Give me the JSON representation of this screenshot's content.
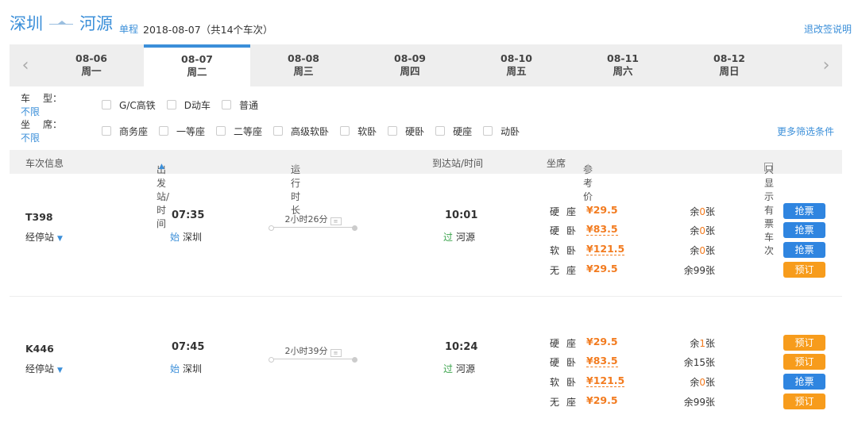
{
  "header": {
    "from": "深圳",
    "to": "河源",
    "trip_type": "单程",
    "date_summary": "2018-08-07（共14个车次）",
    "rules_link": "退改签说明"
  },
  "dates": [
    {
      "date": "08-06",
      "weekday": "周一",
      "active": false
    },
    {
      "date": "08-07",
      "weekday": "周二",
      "active": true
    },
    {
      "date": "08-08",
      "weekday": "周三",
      "active": false
    },
    {
      "date": "08-09",
      "weekday": "周四",
      "active": false
    },
    {
      "date": "08-10",
      "weekday": "周五",
      "active": false
    },
    {
      "date": "08-11",
      "weekday": "周六",
      "active": false
    },
    {
      "date": "08-12",
      "weekday": "周日",
      "active": false
    }
  ],
  "filters": {
    "train_type": {
      "label_a": "车",
      "label_b": "型：",
      "value": "不限",
      "options": [
        "G/C高铁",
        "D动车",
        "普通"
      ]
    },
    "seat_type": {
      "label_a": "坐",
      "label_b": "席：",
      "value": "不限",
      "options": [
        "商务座",
        "一等座",
        "二等座",
        "高级软卧",
        "软卧",
        "硬卧",
        "硬座",
        "动卧"
      ]
    },
    "more": "更多筛选条件"
  },
  "list_header": {
    "train_info": "车次信息",
    "departure": "出发站/时间",
    "duration": "运行时长",
    "arrival": "到达站/时间",
    "seat": "坐席",
    "price": "参考价",
    "only_available": "只显示有票车次"
  },
  "trains": [
    {
      "number": "T398",
      "stops_label": "经停站",
      "dep_time": "07:35",
      "dep_tag": "始",
      "dep_station": "深圳",
      "duration": "2小时26分",
      "arr_time": "10:01",
      "arr_tag": "过",
      "arr_station": "河源",
      "seats": [
        {
          "name": "硬座",
          "price": "¥29.5",
          "remain_pre": "余",
          "remain_n": "0",
          "remain_post": "张",
          "button": "抢票",
          "kind": "blue",
          "dashed": false
        },
        {
          "name": "硬卧",
          "price": "¥83.5",
          "remain_pre": "余",
          "remain_n": "0",
          "remain_post": "张",
          "button": "抢票",
          "kind": "blue",
          "dashed": true
        },
        {
          "name": "软卧",
          "price": "¥121.5",
          "remain_pre": "余",
          "remain_n": "0",
          "remain_post": "张",
          "button": "抢票",
          "kind": "blue",
          "dashed": true
        },
        {
          "name": "无座",
          "price": "¥29.5",
          "remain_pre": "余",
          "remain_n": "99",
          "remain_post": "张",
          "button": "预订",
          "kind": "orange",
          "dashed": false
        }
      ]
    },
    {
      "number": "K446",
      "stops_label": "经停站",
      "dep_time": "07:45",
      "dep_tag": "始",
      "dep_station": "深圳",
      "duration": "2小时39分",
      "arr_time": "10:24",
      "arr_tag": "过",
      "arr_station": "河源",
      "seats": [
        {
          "name": "硬座",
          "price": "¥29.5",
          "remain_pre": "余",
          "remain_n": "1",
          "remain_post": "张",
          "button": "预订",
          "kind": "orange",
          "dashed": false
        },
        {
          "name": "硬卧",
          "price": "¥83.5",
          "remain_pre": "余",
          "remain_n": "15",
          "remain_post": "张",
          "button": "预订",
          "kind": "orange",
          "dashed": true
        },
        {
          "name": "软卧",
          "price": "¥121.5",
          "remain_pre": "余",
          "remain_n": "0",
          "remain_post": "张",
          "button": "抢票",
          "kind": "blue",
          "dashed": true
        },
        {
          "name": "无座",
          "price": "¥29.5",
          "remain_pre": "余",
          "remain_n": "99",
          "remain_post": "张",
          "button": "预订",
          "kind": "orange",
          "dashed": false
        }
      ]
    }
  ],
  "colors": {
    "accent": "#3b8fd9",
    "price": "#f27b1f",
    "btn_blue": "#2f85e0",
    "btn_orange": "#f79c1c",
    "pass_tag": "#3aa34b"
  }
}
